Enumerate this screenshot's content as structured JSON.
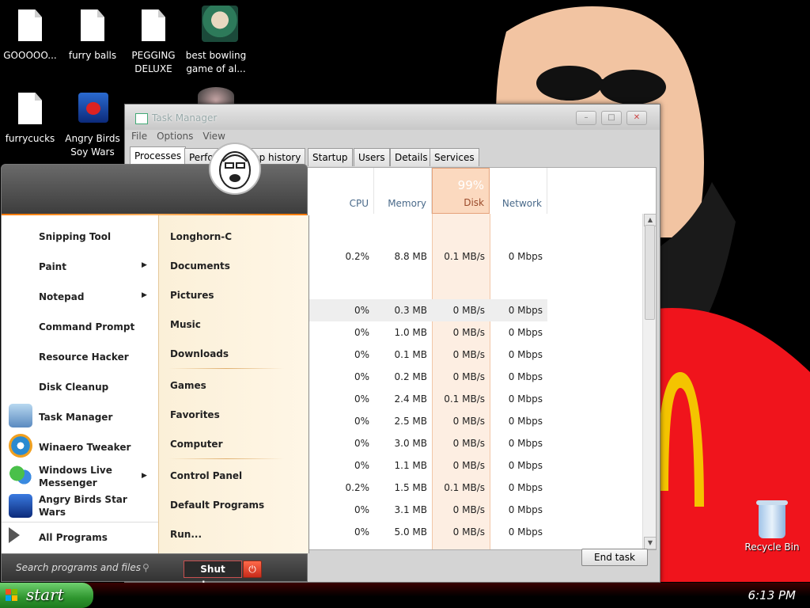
{
  "desktop": {
    "icons": [
      {
        "label": "GOOOOO..."
      },
      {
        "label": "furry balls"
      },
      {
        "label": "PEGGING DELUXE"
      },
      {
        "label": "best bowling game of al..."
      },
      {
        "label": "furrycucks"
      },
      {
        "label": "Angry Birds Soy Wars"
      }
    ],
    "recycle_bin": "Recycle Bin"
  },
  "task_manager": {
    "title": "Task Manager",
    "menu": [
      "File",
      "Options",
      "View"
    ],
    "tabs": [
      "Processes",
      "Perfo",
      "pp history",
      "Startup",
      "Users",
      "Details",
      "Services"
    ],
    "columns": {
      "cpu": {
        "name": "CPU"
      },
      "memory": {
        "name": "Memory"
      },
      "disk": {
        "name": "Disk",
        "percent": "99%"
      },
      "network": {
        "name": "Network"
      }
    },
    "rows": [
      {
        "cpu": "0.2%",
        "memory": "8.8 MB",
        "disk": "0.1 MB/s",
        "network": "0 Mbps"
      },
      {
        "cpu": "0%",
        "memory": "0.3 MB",
        "disk": "0 MB/s",
        "network": "0 Mbps"
      },
      {
        "cpu": "0%",
        "memory": "1.0 MB",
        "disk": "0 MB/s",
        "network": "0 Mbps"
      },
      {
        "cpu": "0%",
        "memory": "0.1 MB",
        "disk": "0 MB/s",
        "network": "0 Mbps"
      },
      {
        "cpu": "0%",
        "memory": "0.2 MB",
        "disk": "0 MB/s",
        "network": "0 Mbps"
      },
      {
        "cpu": "0%",
        "memory": "2.4 MB",
        "disk": "0.1 MB/s",
        "network": "0 Mbps"
      },
      {
        "cpu": "0%",
        "memory": "2.5 MB",
        "disk": "0 MB/s",
        "network": "0 Mbps"
      },
      {
        "cpu": "0%",
        "memory": "3.0 MB",
        "disk": "0 MB/s",
        "network": "0 Mbps"
      },
      {
        "cpu": "0%",
        "memory": "1.1 MB",
        "disk": "0 MB/s",
        "network": "0 Mbps"
      },
      {
        "cpu": "0.2%",
        "memory": "1.5 MB",
        "disk": "0.1 MB/s",
        "network": "0 Mbps"
      },
      {
        "cpu": "0%",
        "memory": "3.1 MB",
        "disk": "0 MB/s",
        "network": "0 Mbps"
      },
      {
        "cpu": "0%",
        "memory": "5.0 MB",
        "disk": "0 MB/s",
        "network": "0 Mbps"
      }
    ],
    "end_task": "End task"
  },
  "start_menu": {
    "left_items": [
      {
        "label": "Snipping Tool",
        "submenu": false
      },
      {
        "label": "Paint",
        "submenu": true
      },
      {
        "label": "Notepad",
        "submenu": true
      },
      {
        "label": "Command Prompt",
        "submenu": false
      },
      {
        "label": "Resource Hacker",
        "submenu": false
      },
      {
        "label": "Disk Cleanup",
        "submenu": false
      },
      {
        "label": "Task Manager",
        "submenu": false
      },
      {
        "label": "Winaero Tweaker",
        "submenu": false
      },
      {
        "label": "Windows Live Messenger",
        "submenu": true
      },
      {
        "label": "Angry Birds Star Wars",
        "submenu": false
      }
    ],
    "all_programs": "All Programs",
    "right_items": [
      "Longhorn-C",
      "Documents",
      "Pictures",
      "Music",
      "Downloads",
      "Games",
      "Favorites",
      "Computer",
      "Control Panel",
      "Default Programs",
      "Run..."
    ],
    "search_placeholder": "Search programs and files",
    "shutdown_label": "Shut down"
  },
  "taskbar": {
    "start_label": "start",
    "clock": "6:13 PM"
  }
}
